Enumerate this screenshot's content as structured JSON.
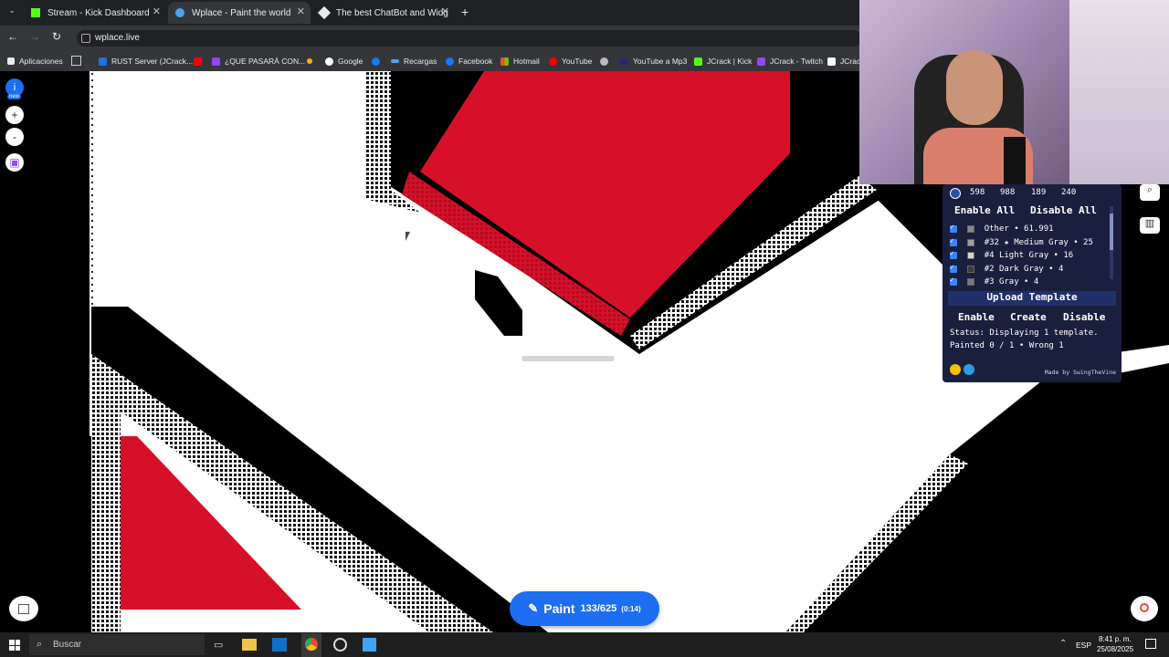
{
  "browser": {
    "tabs": [
      {
        "label": "Stream - Kick Dashboard",
        "active": false
      },
      {
        "label": "Wplace - Paint the world",
        "active": true
      },
      {
        "label": "The best ChatBot and Widg",
        "active": false
      }
    ],
    "url": "wplace.live",
    "bookmarks": [
      "Aplicaciones",
      "RUST Server (JCrack...",
      "¿QUE PASARÁ CON...",
      "Google",
      "Recargas",
      "Facebook",
      "Hotmail",
      "YouTube",
      "YouTube a Mp3",
      "JCrack | Kick",
      "JCrack - Twitch",
      "JCrack"
    ]
  },
  "left_controls": {
    "new_badge": "new",
    "info": "i",
    "zoom_in": "+",
    "zoom_out": "-"
  },
  "panel": {
    "counters": [
      "598",
      "988",
      "189",
      "240"
    ],
    "enable_all": "Enable All",
    "disable_all": "Disable All",
    "colors": [
      {
        "label": "Other • 61.991",
        "swatch": "#888888"
      },
      {
        "label": "#32 ★ Medium Gray • 25",
        "swatch": "#a0a0a0"
      },
      {
        "label": "#4 Light Gray • 16",
        "swatch": "#d2d2d2"
      },
      {
        "label": "#2 Dark Gray • 4",
        "swatch": "#3c3c3c"
      },
      {
        "label": "#3 Gray • 4",
        "swatch": "#787878"
      }
    ],
    "upload_template": "Upload Template",
    "enable": "Enable",
    "create": "Create",
    "disable": "Disable",
    "status_line1": "Status: Displaying 1 template.",
    "status_line2": "Painted 0 / 1 • Wrong 1",
    "credit": "Made by SwingTheVine"
  },
  "paint_button": {
    "label": "Paint",
    "count": "133/625",
    "timer": "(0:14)"
  },
  "taskbar": {
    "search": "Buscar",
    "lang": "ESP",
    "time": "8:41 p. m.",
    "date": "25/08/2025"
  },
  "colors": {
    "accent": "#1d6ef0",
    "red": "#d7102a",
    "panel_bg": "#1a1f3d"
  }
}
